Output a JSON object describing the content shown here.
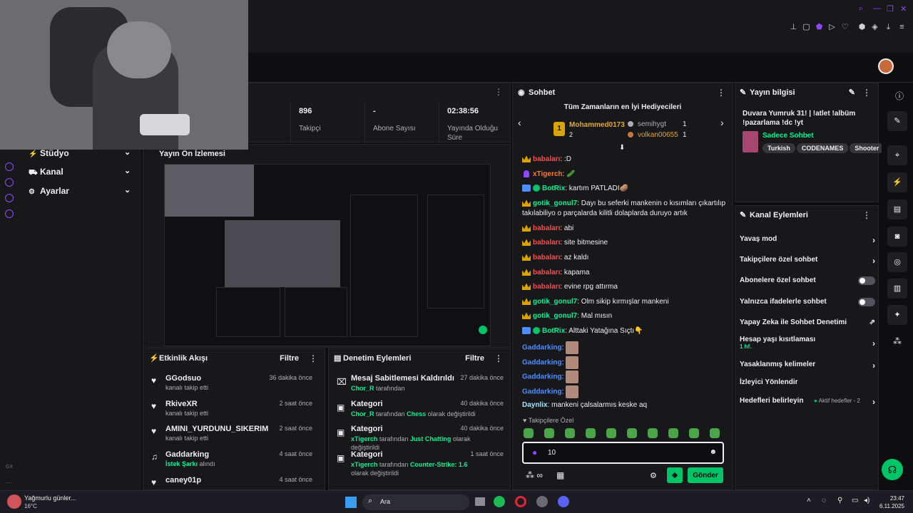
{
  "stats": [
    {
      "value": "896",
      "label": "Takipçi"
    },
    {
      "value": "-",
      "label": "Abone Sayısı"
    },
    {
      "value": "02:38:56",
      "label": "Yayında Olduğu Süre"
    }
  ],
  "nav": [
    {
      "label": "Stüdyo",
      "icon": "bolt-icon"
    },
    {
      "label": "Kanal",
      "icon": "channel-icon"
    },
    {
      "label": "Ayarlar",
      "icon": "gear-icon"
    }
  ],
  "preview": {
    "title": "Yayın Ön İzlemesi"
  },
  "activity": {
    "title": "Etkinlik Akışı",
    "filter": "Filtre",
    "items": [
      {
        "name": "GGodsuo",
        "sub": "kanalı takip etti",
        "time": "36 dakika önce"
      },
      {
        "name": "RkiveXR",
        "sub": "kanalı takip etti",
        "time": "2 saat önce"
      },
      {
        "name": "AMINI_YURDUNU_SIKERIM",
        "sub": "kanalı takip etti",
        "time": "2 saat önce"
      },
      {
        "name": "Gaddarking",
        "sub": "İstek Şarkı",
        "sub2": "alındı",
        "time": "4 saat önce"
      },
      {
        "name": "caney01p",
        "sub": "",
        "time": "4 saat önce"
      }
    ]
  },
  "modlog": {
    "title": "Denetim Eylemleri",
    "filter": "Filtre",
    "items": [
      {
        "name": "Mesaj Sabitlemesi Kaldırıldı",
        "user": "Chor_R",
        "mid": "tarafından",
        "target": "",
        "rest": "",
        "time": "27 dakika önce"
      },
      {
        "name": "Kategori",
        "user": "Chor_R",
        "mid": "tarafından",
        "target": "Chess",
        "rest": "olarak değiştirildi",
        "time": "40 dakika önce"
      },
      {
        "name": "Kategori",
        "user": "xTigerch",
        "mid": "tarafından",
        "target": "Just Chatting",
        "rest": "olarak değiştirildi",
        "time": "40 dakika önce"
      },
      {
        "name": "Kategori",
        "user": "xTigerch",
        "mid": "tarafından",
        "target": "Counter-Strike: 1.6",
        "rest": "olarak değiştirildi",
        "time": "1 saat önce"
      }
    ]
  },
  "chat": {
    "title": "Sohbet",
    "leaderboard_title": "Tüm Zamanların en İyi Hediyecileri",
    "leaders": [
      {
        "rank": "1",
        "name": "Mohammed0173",
        "count": "2"
      },
      {
        "rank": "",
        "name": "semihygt",
        "count": "1"
      },
      {
        "rank": "",
        "name": "volkan00655",
        "count": "1"
      }
    ],
    "messages": [
      {
        "user": "babaları",
        "color": "#ff4a4a",
        "badge": "crown",
        "text": ":D"
      },
      {
        "user": "xTigerch",
        "color": "#ff7a2e",
        "badge": "mic",
        "text": "🥒"
      },
      {
        "user": "BotRix",
        "color": "#00f593",
        "badge": "bot",
        "text": "kartım PATLADI🥔"
      },
      {
        "user": "gotik_gonul7",
        "color": "#00f593",
        "badge": "crown",
        "text": "Dayı bu seferki mankenin o kısımları çıkartılıp takılabiliyo o parçalarda kilitli dolaplarda duruyo artık"
      },
      {
        "user": "babaları",
        "color": "#ff4a4a",
        "badge": "crown",
        "text": "abi"
      },
      {
        "user": "babaları",
        "color": "#ff4a4a",
        "badge": "crown",
        "text": "site bitmesine"
      },
      {
        "user": "babaları",
        "color": "#ff4a4a",
        "badge": "crown",
        "text": "az kaldı"
      },
      {
        "user": "babaları",
        "color": "#ff4a4a",
        "badge": "crown",
        "text": "kapama"
      },
      {
        "user": "babaları",
        "color": "#ff4a4a",
        "badge": "crown",
        "text": "evine rpg attırma"
      },
      {
        "user": "gotik_gonul7",
        "color": "#00f593",
        "badge": "crown",
        "text": "Olm sikip kırmışlar mankeni"
      },
      {
        "user": "gotik_gonul7",
        "color": "#00f593",
        "badge": "crown",
        "text": "Mal mısın"
      },
      {
        "user": "BotRix",
        "color": "#00f593",
        "badge": "bot",
        "text": "Alttaki Yatağına Sıçtı👇"
      },
      {
        "user": "Gaddarking",
        "color": "#4f8df7",
        "badge": "",
        "text": ""
      },
      {
        "user": "Gaddarking",
        "color": "#4f8df7",
        "badge": "",
        "text": ""
      },
      {
        "user": "Gaddarking",
        "color": "#4f8df7",
        "badge": "",
        "text": ""
      },
      {
        "user": "Gaddarking",
        "color": "#4f8df7",
        "badge": "",
        "text": ""
      },
      {
        "user": "Daynlix",
        "color": "#9fe5ff",
        "badge": "",
        "text": "mankeni çalsalarmıs keske aq"
      }
    ],
    "followers_only": "Takipçilere Özel",
    "input_value": "10",
    "send": "Gönder"
  },
  "stream_info": {
    "title": "Yayın bilgisi",
    "stream_title": "Duvara Yumruk 31! | !atlet !albüm !pazarlama !dc !yt",
    "category": "Sadece Sohbet",
    "tags": [
      "Turkish",
      "CODENAMES",
      "Shooter"
    ]
  },
  "channel_actions": {
    "title": "Kanal Eylemleri",
    "rows": [
      {
        "label": "Yavaş mod",
        "kind": "chev"
      },
      {
        "label": "Takipçilere özel sohbet",
        "kind": "chev"
      },
      {
        "label": "Abonelere özel sohbet",
        "kind": "toggle"
      },
      {
        "label": "Yalnızca ifadelerle sohbet",
        "kind": "toggle"
      },
      {
        "label": "Yapay Zeka ile Sohbet Denetimi",
        "kind": "ext"
      },
      {
        "label": "Hesap yaşı kısıtlaması",
        "sub": "1 hf.",
        "kind": "chev"
      },
      {
        "label": "Yasaklanmış kelimeler",
        "kind": "chev"
      },
      {
        "label": "İzleyici Yönlendir",
        "kind": "none"
      },
      {
        "label": "Hedefleri belirleyin",
        "sub": "Aktif hedefler - 2",
        "kind": "chev"
      }
    ]
  },
  "taskbar": {
    "weather_title": "Yağmurlu günler...",
    "weather_temp": "16°C",
    "search": "Ara",
    "time": "23:47",
    "date": "6.11.2025"
  },
  "left_rail_label": "GX",
  "colors": {
    "accent": "#9147ff",
    "green": "#00f593",
    "panel": "#18181b"
  }
}
